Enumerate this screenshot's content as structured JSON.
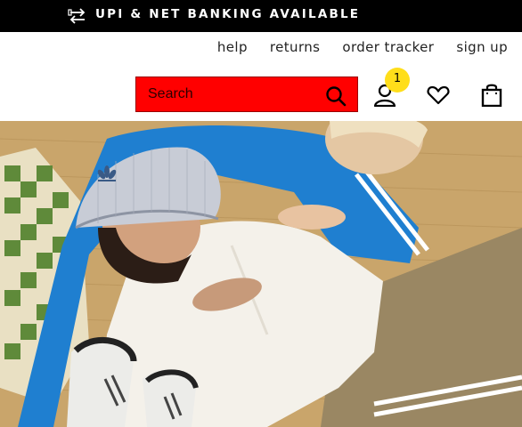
{
  "promo": {
    "text": "UPI & NET BANKING AVAILABLE",
    "icon": "exchange-arrows-icon",
    "background": "#000000"
  },
  "utility_links": [
    {
      "label": "help"
    },
    {
      "label": "returns"
    },
    {
      "label": "order tracker"
    },
    {
      "label": "sign up"
    }
  ],
  "search": {
    "placeholder": "Search",
    "value": "",
    "background": "#ff0000",
    "icon": "search-icon"
  },
  "header_icons": {
    "account": "user-icon",
    "account_badge": "1",
    "badge_color": "#ffde1a",
    "wishlist": "heart-icon",
    "bag": "shopping-bag-icon"
  },
  "hero": {
    "image": "hero-photo",
    "description_colors": {
      "floor": "#c9a56b",
      "jacket": "#1f7fd0",
      "sweater": "#f4f1ea",
      "pants": "#9a8763",
      "checker_green": "#5f8a3a"
    }
  }
}
